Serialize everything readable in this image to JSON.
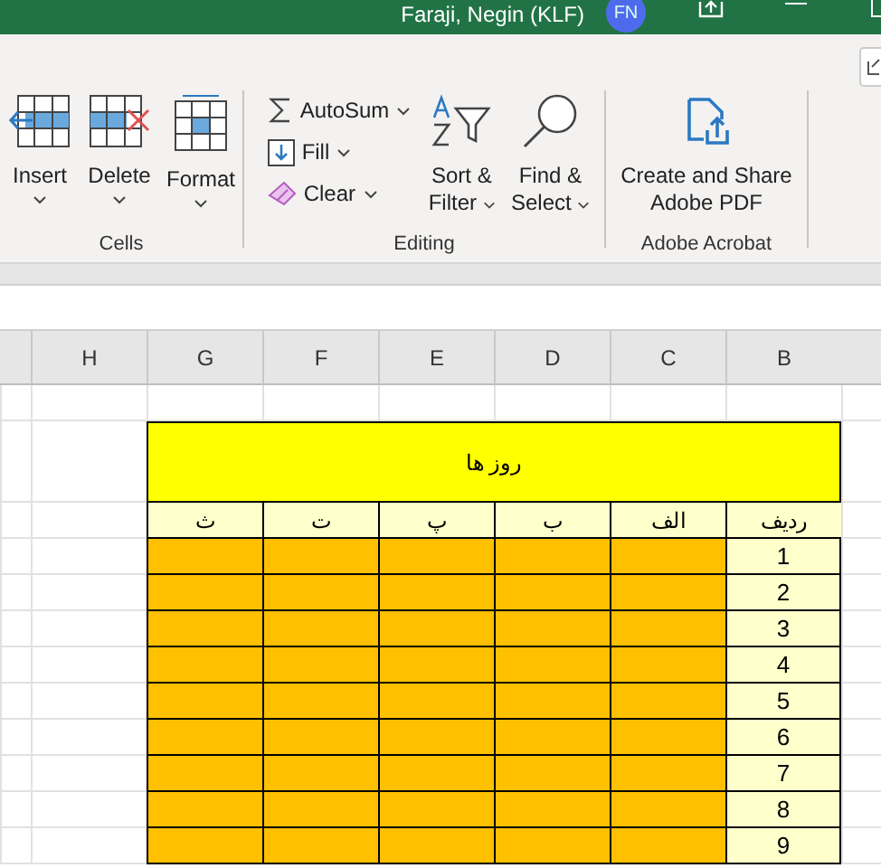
{
  "title_bar": {
    "user": "Faraji, Negin (KLF)",
    "initials": "FN"
  },
  "ribbon": {
    "groups": [
      {
        "label": "Cells",
        "items": [
          {
            "kind": "insert",
            "label": "Insert"
          },
          {
            "kind": "delete",
            "label": "Delete"
          },
          {
            "kind": "format",
            "label": "Format"
          }
        ]
      },
      {
        "label": "Editing",
        "items": [
          {
            "kind": "autosum",
            "label": "AutoSum"
          },
          {
            "kind": "fill",
            "label": "Fill"
          },
          {
            "kind": "clear",
            "label": "Clear"
          },
          {
            "kind": "sort",
            "label": "Sort & Filter"
          },
          {
            "kind": "find",
            "label": "Find & Select"
          }
        ]
      },
      {
        "label": "Adobe Acrobat",
        "items": [
          {
            "kind": "pdf",
            "label": "Create and Share Adobe PDF"
          }
        ]
      }
    ]
  },
  "sheet": {
    "columns": [
      "H",
      "G",
      "F",
      "E",
      "D",
      "C",
      "B"
    ],
    "table": {
      "title": "روز ها",
      "headers": [
        "ردیف",
        "الف",
        "ب",
        "پ",
        "ت",
        "ث"
      ],
      "rows": [
        "1",
        "2",
        "3",
        "4",
        "5",
        "6",
        "7",
        "8",
        "9"
      ]
    }
  }
}
